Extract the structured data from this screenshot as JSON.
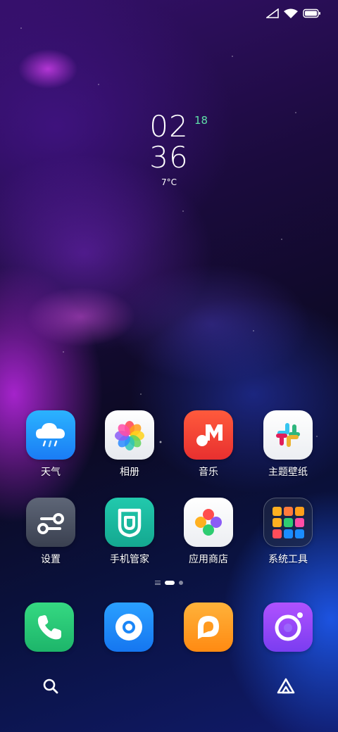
{
  "status_bar": {
    "icons": [
      "cellular-signal-icon",
      "wifi-icon",
      "battery-icon"
    ]
  },
  "clock": {
    "hours": "02",
    "minutes": "36",
    "date": "18",
    "temperature": "7°C"
  },
  "apps": [
    {
      "label": "天气",
      "icon": "weather-icon"
    },
    {
      "label": "相册",
      "icon": "gallery-icon"
    },
    {
      "label": "音乐",
      "icon": "music-icon"
    },
    {
      "label": "主题壁纸",
      "icon": "themes-icon"
    },
    {
      "label": "设置",
      "icon": "settings-icon"
    },
    {
      "label": "手机管家",
      "icon": "security-icon"
    },
    {
      "label": "应用商店",
      "icon": "app-store-icon"
    },
    {
      "label": "系统工具",
      "icon": "folder-icon"
    }
  ],
  "dock": [
    {
      "icon": "phone-icon"
    },
    {
      "icon": "messages-icon"
    },
    {
      "icon": "chat-icon"
    },
    {
      "icon": "camera-icon"
    }
  ],
  "bottom_bar": {
    "left_icon": "search-icon",
    "right_icon": "assistant-icon"
  },
  "colors": {
    "date_accent": "#5fe0a8",
    "weather": "#1e9bff",
    "music": "#f0443a",
    "security": "#1ab9a0",
    "phone": "#2ecc71",
    "messages": "#1a8cff",
    "chat": "#ff9f1a",
    "camera": "#9b4dff"
  }
}
